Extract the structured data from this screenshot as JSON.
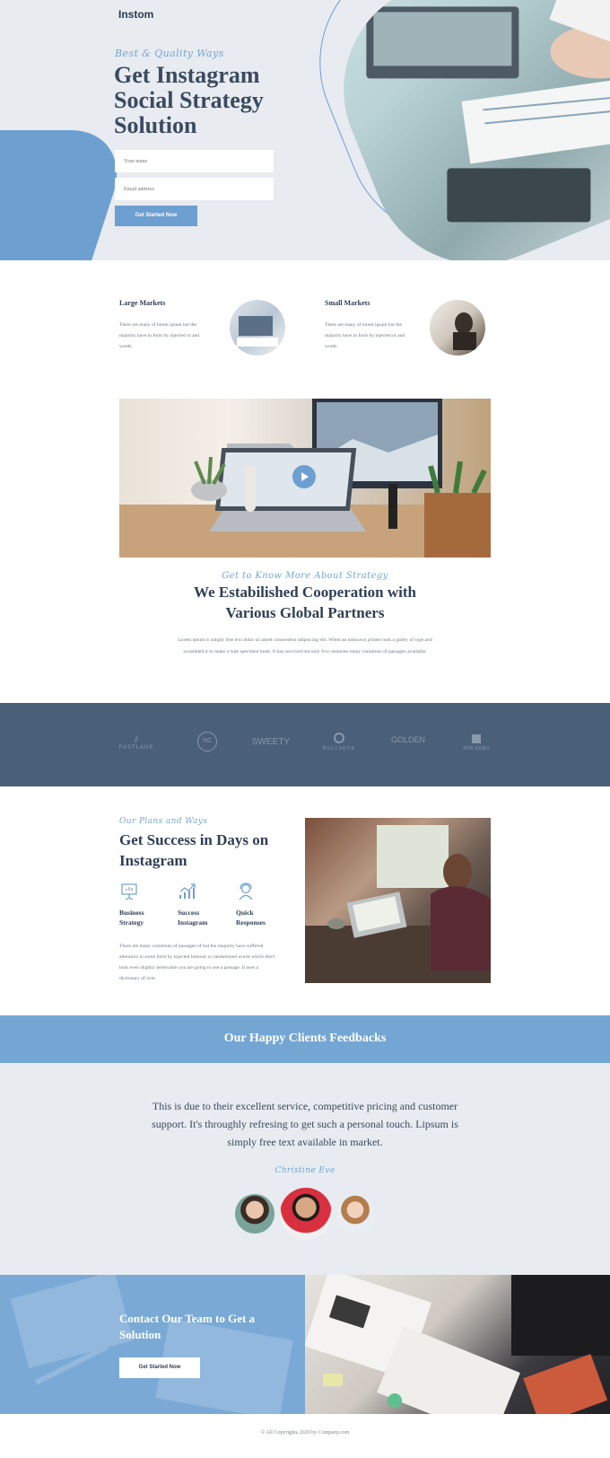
{
  "brand": {
    "logo": "Instom"
  },
  "hero": {
    "tagline": "Best & Quality Ways",
    "title": "Get Instagram Social Strategy Solution",
    "name_placeholder": "Your name",
    "email_placeholder": "Email address",
    "cta": "Get Started Now"
  },
  "markets": [
    {
      "title": "Large Markets",
      "text": "There are many of lorem ipsum but the majority have in form by injected or and words."
    },
    {
      "title": "Small Markets",
      "text": "There are many of lorem ipsum but the majority have in form by injected or and words."
    }
  ],
  "about": {
    "tagline": "Get to Know More About Strategy",
    "title_line1": "We Estabilished Cooperation with",
    "title_line2": "Various Global Partners",
    "text": "Lorem ipsum is simply free text dolor sit amett consectetur adipiscing elit. When an unknown printer took a galley of type and scrambled it to make a type specimen book. It has survived not only five centuries many variations of passages available."
  },
  "partners": [
    "FASTLANE",
    "NC",
    "SWEETY",
    "BULLSEYE",
    "GOLDEN",
    "RON JONES"
  ],
  "success": {
    "tagline": "Our Plans and Ways",
    "title": "Get Success in Days on Instagram",
    "features": [
      {
        "label_line1": "Business",
        "label_line2": "Strategy",
        "icon": "presentation-board-icon"
      },
      {
        "label_line1": "Success",
        "label_line2": "Instagram",
        "icon": "growth-chart-icon"
      },
      {
        "label_line1": "Quick",
        "label_line2": "Responses",
        "icon": "support-agent-icon"
      }
    ],
    "text": "There are many variations of passages of but the majority have suffered alteration in some form by injected humour or randomised words which don't look even slightly believable you are going to use a passage. It uses a dictionary of over."
  },
  "feedback": {
    "heading": "Our Happy Clients Feedbacks",
    "quote": "This is due to their excellent service, competitive pricing and customer support. It's throughly refresing to get such a personal touch. Lipsum is simply free text available in market.",
    "author": "Christine Eve"
  },
  "contact": {
    "title": "Contact Our Team to Get a Solution",
    "cta": "Get Started Now"
  },
  "footer": {
    "copyright": "© All Copyrights 2020 by Company.com"
  }
}
